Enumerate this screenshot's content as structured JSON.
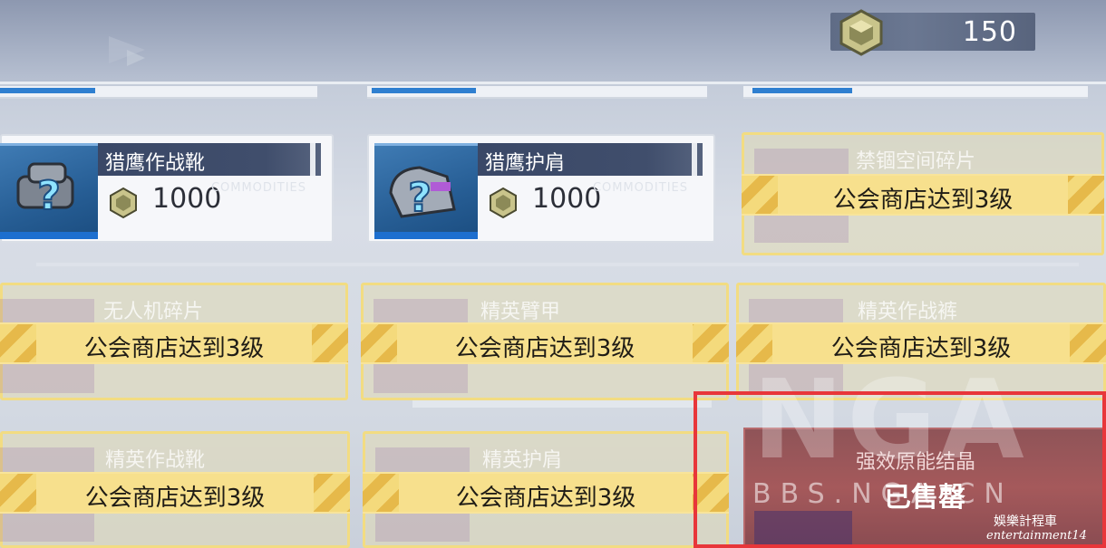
{
  "currency": {
    "icon": "hex-coin-icon",
    "amount": "150"
  },
  "colors": {
    "locked_banner": "#f4da7c",
    "sold_bg": "#a5595b",
    "accent_blue": "#2f7fd0",
    "highlight_border": "#e8363a"
  },
  "items_available": [
    {
      "name": "猎鹰作战靴",
      "price": "1000",
      "icon": "boots-unknown-icon",
      "watermark": "COMMODITIES"
    },
    {
      "name": "猎鹰护肩",
      "price": "1000",
      "icon": "shoulder-unknown-icon",
      "watermark": "COMMODITIES"
    }
  ],
  "items_locked": [
    {
      "name": "禁锢空间碎片",
      "lock_text": "公会商店达到3级"
    },
    {
      "name": "无人机碎片",
      "lock_text": "公会商店达到3级"
    },
    {
      "name": "精英臂甲",
      "lock_text": "公会商店达到3级"
    },
    {
      "name": "精英作战裤",
      "lock_text": "公会商店达到3级"
    },
    {
      "name": "精英作战靴",
      "lock_text": "公会商店达到3级"
    },
    {
      "name": "精英护肩",
      "lock_text": "公会商店达到3级"
    }
  ],
  "item_sold": {
    "name": "强效原能结晶",
    "status": "已售罄"
  },
  "watermarks": {
    "big": "NGA",
    "url": "BBS.NGA.CN",
    "ent_line1": "娛樂計程車",
    "ent_line2": "entertainment14"
  }
}
